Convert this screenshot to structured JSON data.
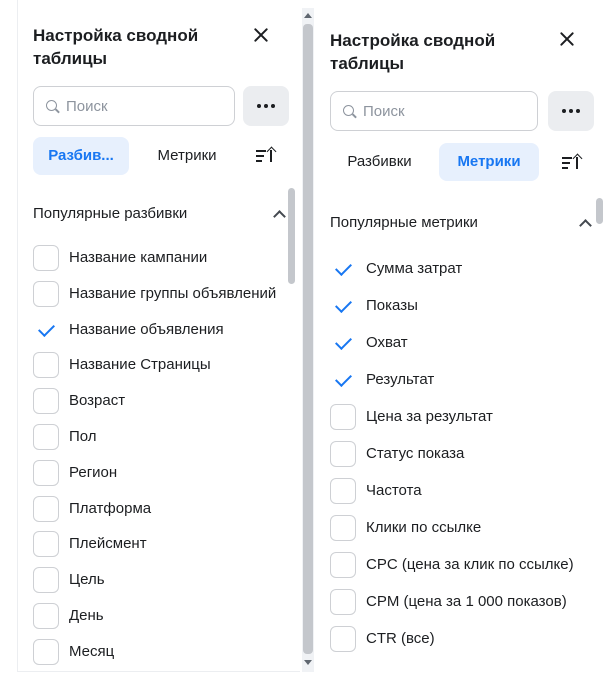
{
  "left": {
    "title_line1": "Настройка сводной",
    "title_line2": "таблицы",
    "search_placeholder": "Поиск",
    "tabs": [
      {
        "label": "Разбив...",
        "active": true
      },
      {
        "label": "Метрики",
        "active": false
      }
    ],
    "section_title": "Популярные разбивки",
    "items": [
      {
        "label": "Название кампании",
        "checked": false
      },
      {
        "label": "Название группы объявлений",
        "checked": false
      },
      {
        "label": "Название объявления",
        "checked": true
      },
      {
        "label": "Название Страницы",
        "checked": false
      },
      {
        "label": "Возраст",
        "checked": false
      },
      {
        "label": "Пол",
        "checked": false
      },
      {
        "label": "Регион",
        "checked": false
      },
      {
        "label": "Платформа",
        "checked": false
      },
      {
        "label": "Плейсмент",
        "checked": false
      },
      {
        "label": "Цель",
        "checked": false
      },
      {
        "label": "День",
        "checked": false
      },
      {
        "label": "Месяц",
        "checked": false
      }
    ]
  },
  "right": {
    "title_line1": "Настройка сводной",
    "title_line2": "таблицы",
    "search_placeholder": "Поиск",
    "tabs": [
      {
        "label": "Разбивки",
        "active": false
      },
      {
        "label": "Метрики",
        "active": true
      }
    ],
    "section_title": "Популярные метрики",
    "items": [
      {
        "label": "Сумма затрат",
        "checked": true
      },
      {
        "label": "Показы",
        "checked": true
      },
      {
        "label": "Охват",
        "checked": true
      },
      {
        "label": "Результат",
        "checked": true
      },
      {
        "label": "Цена за результат",
        "checked": false
      },
      {
        "label": "Статус показа",
        "checked": false
      },
      {
        "label": "Частота",
        "checked": false
      },
      {
        "label": "Клики по ссылке",
        "checked": false
      },
      {
        "label": "CPC (цена за клик по ссылке)",
        "checked": false
      },
      {
        "label": "CPM (цена за 1 000 показов)",
        "checked": false
      },
      {
        "label": "CTR (все)",
        "checked": false
      }
    ]
  },
  "colors": {
    "accent": "#1877f2",
    "active_tab_bg": "#e7f0fd",
    "border": "#ced0d4",
    "text": "#1c1e21"
  },
  "icons": [
    "close-icon",
    "search-icon",
    "more-icon",
    "sort-icon",
    "chevron-up-icon",
    "checkmark-icon"
  ]
}
